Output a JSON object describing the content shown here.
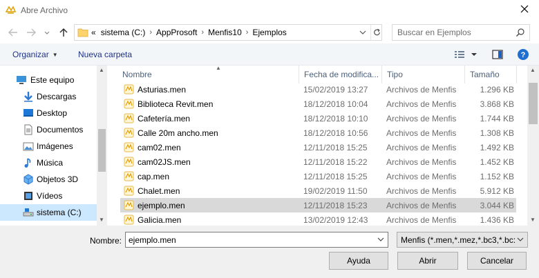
{
  "window": {
    "title": "Abre Archivo"
  },
  "address": {
    "crumbs": [
      "sistema (C:)",
      "AppProsoft",
      "Menfis10",
      "Ejemplos"
    ],
    "overflow": "«"
  },
  "search": {
    "placeholder": "Buscar en Ejemplos"
  },
  "toolbar": {
    "organize": "Organizar",
    "new_folder": "Nueva carpeta"
  },
  "nav": {
    "items": [
      {
        "label": "Este equipo",
        "icon": "computer-icon"
      },
      {
        "label": "Descargas",
        "icon": "downloads-icon"
      },
      {
        "label": "Desktop",
        "icon": "desktop-icon"
      },
      {
        "label": "Documentos",
        "icon": "documents-icon"
      },
      {
        "label": "Imágenes",
        "icon": "pictures-icon"
      },
      {
        "label": "Música",
        "icon": "music-icon"
      },
      {
        "label": "Objetos 3D",
        "icon": "objects-3d-icon"
      },
      {
        "label": "Vídeos",
        "icon": "videos-icon"
      },
      {
        "label": "sistema (C:)",
        "icon": "drive-icon",
        "selected": true
      }
    ]
  },
  "columns": {
    "name": "Nombre",
    "date": "Fecha de modifica...",
    "type": "Tipo",
    "size": "Tamaño"
  },
  "files": [
    {
      "name": "Asturias.men",
      "date": "15/02/2019 13:27",
      "type": "Archivos de Menfis",
      "size": "1.296 KB"
    },
    {
      "name": "Biblioteca Revit.men",
      "date": "18/12/2018 10:04",
      "type": "Archivos de Menfis",
      "size": "3.868 KB"
    },
    {
      "name": "Cafetería.men",
      "date": "18/12/2018 10:10",
      "type": "Archivos de Menfis",
      "size": "1.744 KB"
    },
    {
      "name": "Calle 20m ancho.men",
      "date": "18/12/2018 10:56",
      "type": "Archivos de Menfis",
      "size": "1.308 KB"
    },
    {
      "name": "cam02.men",
      "date": "12/11/2018 15:25",
      "type": "Archivos de Menfis",
      "size": "1.492 KB"
    },
    {
      "name": "cam02JS.men",
      "date": "12/11/2018 15:22",
      "type": "Archivos de Menfis",
      "size": "1.452 KB"
    },
    {
      "name": "cap.men",
      "date": "12/11/2018 15:25",
      "type": "Archivos de Menfis",
      "size": "1.152 KB"
    },
    {
      "name": "Chalet.men",
      "date": "19/02/2019 11:50",
      "type": "Archivos de Menfis",
      "size": "5.912 KB"
    },
    {
      "name": "ejemplo.men",
      "date": "12/11/2018 15:23",
      "type": "Archivos de Menfis",
      "size": "3.044 KB",
      "selected": true
    },
    {
      "name": "Galicia.men",
      "date": "13/02/2019 12:43",
      "type": "Archivos de Menfis",
      "size": "1.436 KB"
    }
  ],
  "bottom": {
    "name_label": "Nombre:",
    "name_value": "ejemplo.men",
    "filter_value": "Menfis (*.men,*.mez,*.bc3,*.bc:",
    "help": "Ayuda",
    "open": "Abrir",
    "cancel": "Cancelar"
  }
}
